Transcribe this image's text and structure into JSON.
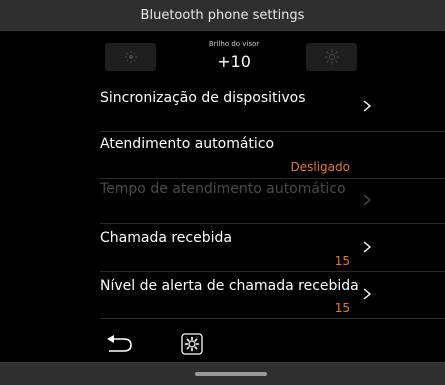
{
  "header": {
    "title": "Bluetooth phone settings"
  },
  "brightness": {
    "label": "Brilho do visor",
    "value": "+10",
    "decrease_icon": "sun-dim-icon",
    "increase_icon": "sun-bright-icon"
  },
  "settings": [
    {
      "label": "Sincronização de dispositivos",
      "value": "",
      "has_chevron": true,
      "enabled": true
    },
    {
      "label": "Atendimento automático",
      "value": "Desligado",
      "has_chevron": false,
      "enabled": true
    },
    {
      "label": "Tempo de atendimento automático",
      "value": "",
      "has_chevron": true,
      "enabled": false
    },
    {
      "label": "Chamada recebida",
      "value": "15",
      "has_chevron": true,
      "enabled": true
    },
    {
      "label": "Nível de alerta de chamada recebida",
      "value": "15",
      "has_chevron": true,
      "enabled": true
    }
  ],
  "footer": {
    "back_icon": "back-arrow-icon",
    "settings_icon": "gear-icon"
  },
  "colors": {
    "accent": "#e0792c",
    "disabled_text": "#4a4a4a",
    "bar_background": "#2f2f2f"
  }
}
